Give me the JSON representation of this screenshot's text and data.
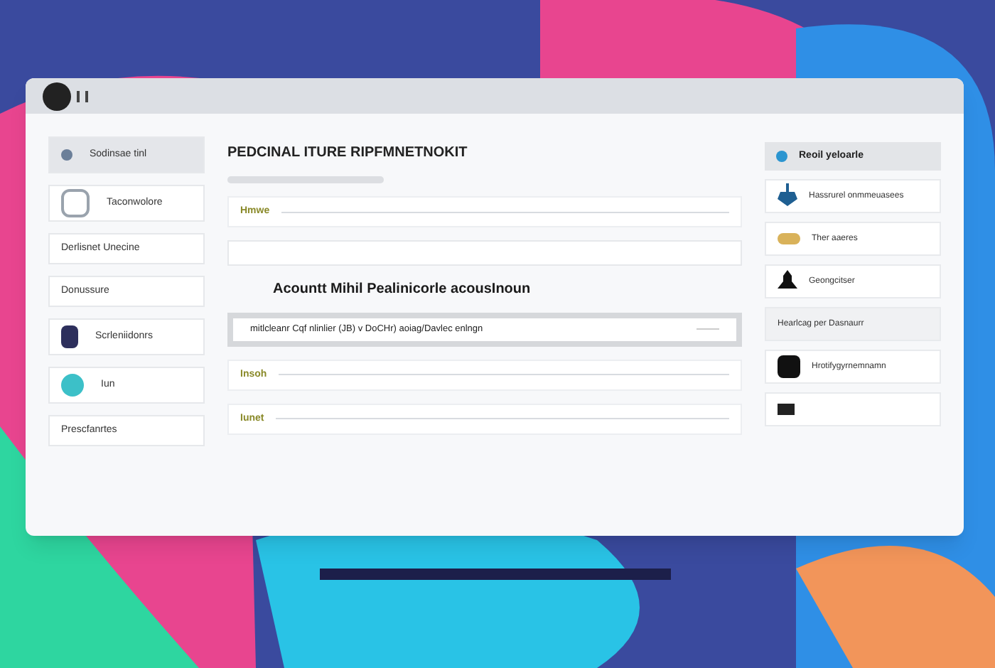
{
  "sidebar": {
    "items": [
      {
        "label": "Sodinsae tinl",
        "selected": true
      },
      {
        "label": "Taconwolore",
        "selected": false
      },
      {
        "label": "Derlisnet Unecine",
        "selected": false
      },
      {
        "label": "Donussure",
        "selected": false
      },
      {
        "label": "Scrleniidonrs",
        "selected": false
      },
      {
        "label": "Iun",
        "selected": false
      },
      {
        "label": "Prescfanrtes",
        "selected": false
      }
    ]
  },
  "main": {
    "title": "PEDCINAL ITURE RIPFMNETNOKIT",
    "progress": {
      "level": 1
    },
    "rows": [
      {
        "kind": "field",
        "label": "Hmwe"
      },
      {
        "kind": "blank"
      },
      {
        "kind": "heading",
        "text": "Acountt Mihil Pealinicorle acousInoun"
      },
      {
        "kind": "option",
        "text": "mitlcleanr Cqf nlinlier (JB) v DoCHr) aoiag/Davlec enlngn"
      },
      {
        "kind": "field",
        "label": "Insoh"
      },
      {
        "kind": "field",
        "label": "Iunet"
      }
    ]
  },
  "panel": {
    "header": "Reoil yeloarle",
    "items": [
      {
        "label": "Hassrurel onmmeuasees"
      },
      {
        "label": "Ther aaeres"
      },
      {
        "label": "Geongcitser"
      },
      {
        "label": "Hearlcag per Dasnaurr"
      },
      {
        "label": "Hrotifygyrnemnamn"
      }
    ]
  }
}
